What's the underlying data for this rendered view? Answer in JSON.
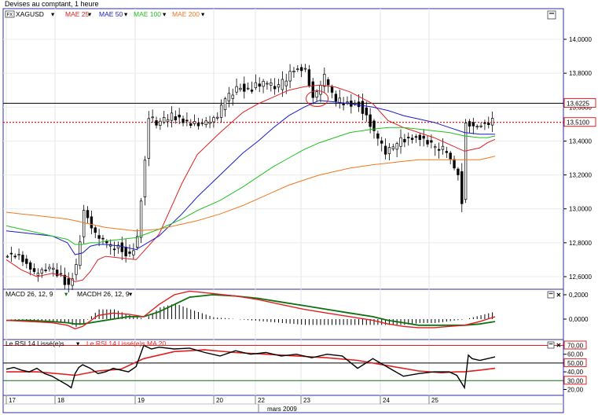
{
  "header": {
    "title": "Devises au comptant, 1 heure"
  },
  "colors": {
    "price": "#000000",
    "mae25": "#e02020",
    "mae50": "#1a1acc",
    "mae100": "#20c020",
    "mae200": "#f07820",
    "macd": "#e02020",
    "macd_signal": "#107010",
    "rsi": "#000000",
    "rsi_smooth": "#e02020",
    "current_price": "#e00000",
    "resistance": "#000000",
    "frame": "#3030a0"
  },
  "icons": {
    "symbol_badge": "fx-badge-icon",
    "maximize": "maximize-icon",
    "close": "close-icon"
  },
  "chart_data": [
    {
      "type": "line",
      "panel": "price",
      "series_type": "candlestick",
      "legend": [
        "XAGUSD",
        "MAE 25",
        "MAE 50",
        "MAE 100",
        "MAE 200"
      ],
      "legend_placement": "top-left",
      "y_ticks": [
        "14,0000",
        "13,8000",
        "13,6000",
        "13,4000",
        "13,2000",
        "13,0000",
        "12,8000",
        "12,6000"
      ],
      "ylim": [
        12.5,
        14.2
      ],
      "x_ticks": [
        "17",
        "18",
        "19",
        "20",
        "22",
        "23",
        "24",
        "25"
      ],
      "xlabel": "mars 2009",
      "grid": true,
      "current_price": {
        "value": 13.51,
        "label": "13,5100"
      },
      "level_line": {
        "value": 13.6225,
        "label": "13,6225"
      },
      "annotations": [
        {
          "type": "ellipse",
          "x": 81,
          "y": 13.65
        }
      ],
      "ohlc": [],
      "series": [
        {
          "name": "MAE 25",
          "x": [
            0,
            4,
            8,
            12,
            16,
            18,
            20,
            22,
            24,
            26,
            30,
            34,
            40,
            46,
            50,
            56,
            62,
            66,
            70,
            74,
            78,
            82,
            86,
            90,
            96,
            100,
            104,
            108,
            112,
            116,
            120,
            124,
            126,
            128
          ],
          "values": [
            12.7,
            12.64,
            12.6,
            12.62,
            12.6,
            12.57,
            12.58,
            12.63,
            12.7,
            12.72,
            12.71,
            12.7,
            12.85,
            13.15,
            13.32,
            13.45,
            13.57,
            13.62,
            13.66,
            13.7,
            13.72,
            13.73,
            13.72,
            13.69,
            13.62,
            13.52,
            13.48,
            13.45,
            13.42,
            13.38,
            13.34,
            13.36,
            13.39,
            13.41
          ]
        },
        {
          "name": "MAE 50",
          "x": [
            0,
            4,
            8,
            12,
            16,
            18,
            20,
            22,
            24,
            26,
            30,
            34,
            40,
            46,
            50,
            56,
            62,
            66,
            70,
            74,
            78,
            82,
            86,
            90,
            96,
            100,
            104,
            108,
            112,
            116,
            120,
            124,
            126,
            128
          ],
          "values": [
            12.87,
            12.86,
            12.85,
            12.84,
            12.8,
            12.73,
            12.74,
            12.78,
            12.79,
            12.79,
            12.78,
            12.76,
            12.84,
            12.97,
            13.07,
            13.2,
            13.33,
            13.4,
            13.48,
            13.55,
            13.6,
            13.64,
            13.63,
            13.62,
            13.6,
            13.58,
            13.55,
            13.53,
            13.51,
            13.48,
            13.45,
            13.44,
            13.44,
            13.44
          ]
        },
        {
          "name": "MAE 100",
          "x": [
            0,
            4,
            8,
            12,
            16,
            18,
            20,
            22,
            24,
            26,
            30,
            34,
            40,
            46,
            50,
            56,
            62,
            66,
            70,
            74,
            78,
            82,
            86,
            90,
            96,
            100,
            104,
            108,
            112,
            116,
            120,
            124,
            126,
            128
          ],
          "values": [
            12.9,
            12.88,
            12.86,
            12.84,
            12.82,
            12.79,
            12.79,
            12.8,
            12.8,
            12.81,
            12.82,
            12.83,
            12.88,
            12.94,
            12.99,
            13.05,
            13.13,
            13.19,
            13.25,
            13.3,
            13.35,
            13.39,
            13.42,
            13.45,
            13.47,
            13.48,
            13.48,
            13.47,
            13.46,
            13.45,
            13.43,
            13.42,
            13.42,
            13.43
          ]
        },
        {
          "name": "MAE 200",
          "x": [
            0,
            4,
            8,
            12,
            16,
            18,
            20,
            22,
            24,
            26,
            30,
            34,
            40,
            46,
            50,
            56,
            62,
            66,
            70,
            74,
            78,
            82,
            86,
            90,
            96,
            100,
            104,
            108,
            112,
            116,
            120,
            124,
            126,
            128
          ],
          "values": [
            12.98,
            12.97,
            12.96,
            12.95,
            12.94,
            12.93,
            12.92,
            12.91,
            12.9,
            12.89,
            12.88,
            12.87,
            12.88,
            12.91,
            12.93,
            12.97,
            13.02,
            13.06,
            13.1,
            13.14,
            13.17,
            13.2,
            13.22,
            13.24,
            13.26,
            13.27,
            13.28,
            13.29,
            13.29,
            13.29,
            13.29,
            13.29,
            13.3,
            13.31
          ]
        }
      ]
    },
    {
      "type": "line",
      "panel": "macd",
      "legend": [
        "MACD  26, 12, 9",
        "MACDH 26, 12, 9"
      ],
      "y_ticks": [
        "0,2000",
        "0,0000"
      ],
      "ylim": [
        -0.12,
        0.24
      ],
      "series": [
        {
          "name": "MACD  26, 12, 9",
          "x": [
            0,
            6,
            12,
            16,
            18,
            20,
            24,
            28,
            32,
            36,
            40,
            44,
            48,
            54,
            60,
            66,
            72,
            78,
            84,
            90,
            96,
            100,
            104,
            108,
            112,
            116,
            120,
            124,
            126,
            128
          ],
          "values": [
            -0.01,
            -0.02,
            -0.03,
            -0.05,
            -0.08,
            -0.06,
            0.03,
            0.05,
            0.04,
            0.02,
            0.12,
            0.2,
            0.23,
            0.21,
            0.19,
            0.16,
            0.12,
            0.08,
            0.05,
            0.02,
            -0.01,
            -0.04,
            -0.06,
            -0.07,
            -0.07,
            -0.06,
            -0.05,
            -0.02,
            0.0,
            0.02
          ]
        },
        {
          "name": "signal",
          "x": [
            0,
            6,
            12,
            16,
            18,
            20,
            24,
            28,
            32,
            36,
            40,
            44,
            48,
            54,
            60,
            66,
            72,
            78,
            84,
            90,
            96,
            100,
            104,
            108,
            112,
            116,
            120,
            124,
            126,
            128
          ],
          "values": [
            -0.01,
            -0.01,
            -0.02,
            -0.03,
            -0.04,
            -0.04,
            -0.02,
            0.0,
            0.02,
            0.02,
            0.06,
            0.12,
            0.18,
            0.2,
            0.19,
            0.17,
            0.14,
            0.11,
            0.08,
            0.05,
            0.02,
            -0.01,
            -0.03,
            -0.05,
            -0.05,
            -0.05,
            -0.05,
            -0.04,
            -0.03,
            -0.02
          ]
        }
      ]
    },
    {
      "type": "line",
      "panel": "rsi",
      "legend": [
        "Le RSI 14 Lissé(e)s",
        "Le RSI 14 Lissé(e)s MA 20"
      ],
      "y_ticks": [
        "70,00",
        "60,00",
        "50,00",
        "40,00",
        "30,00",
        "20,00"
      ],
      "ylim": [
        15,
        75
      ],
      "levels": [
        70,
        50,
        30
      ],
      "series": [
        {
          "name": "Le RSI 14 Lissé(e)s",
          "x": [
            0,
            2,
            4,
            6,
            8,
            10,
            12,
            14,
            16,
            17,
            18,
            19,
            20,
            22,
            24,
            26,
            28,
            30,
            32,
            34,
            36,
            38,
            40,
            44,
            48,
            52,
            56,
            60,
            64,
            68,
            72,
            76,
            80,
            84,
            88,
            92,
            96,
            100,
            104,
            108,
            112,
            116,
            118,
            120,
            121,
            122,
            124,
            126,
            128
          ],
          "values": [
            43,
            45,
            42,
            40,
            44,
            38,
            35,
            30,
            25,
            22,
            38,
            45,
            48,
            44,
            38,
            40,
            44,
            42,
            40,
            46,
            70,
            66,
            68,
            66,
            67,
            62,
            58,
            64,
            60,
            62,
            58,
            60,
            56,
            60,
            58,
            44,
            55,
            45,
            35,
            38,
            40,
            40,
            36,
            22,
            59,
            55,
            53,
            55,
            57
          ]
        },
        {
          "name": "Le RSI 14 Lissé(e)s MA 20",
          "x": [
            0,
            8,
            16,
            18,
            24,
            30,
            36,
            44,
            52,
            60,
            68,
            76,
            84,
            92,
            100,
            108,
            114,
            118,
            120,
            124,
            128
          ],
          "values": [
            40,
            40,
            37,
            36,
            41,
            43,
            55,
            63,
            65,
            62,
            60,
            58,
            56,
            53,
            47,
            41,
            39,
            40,
            40,
            42,
            44
          ]
        }
      ]
    }
  ]
}
